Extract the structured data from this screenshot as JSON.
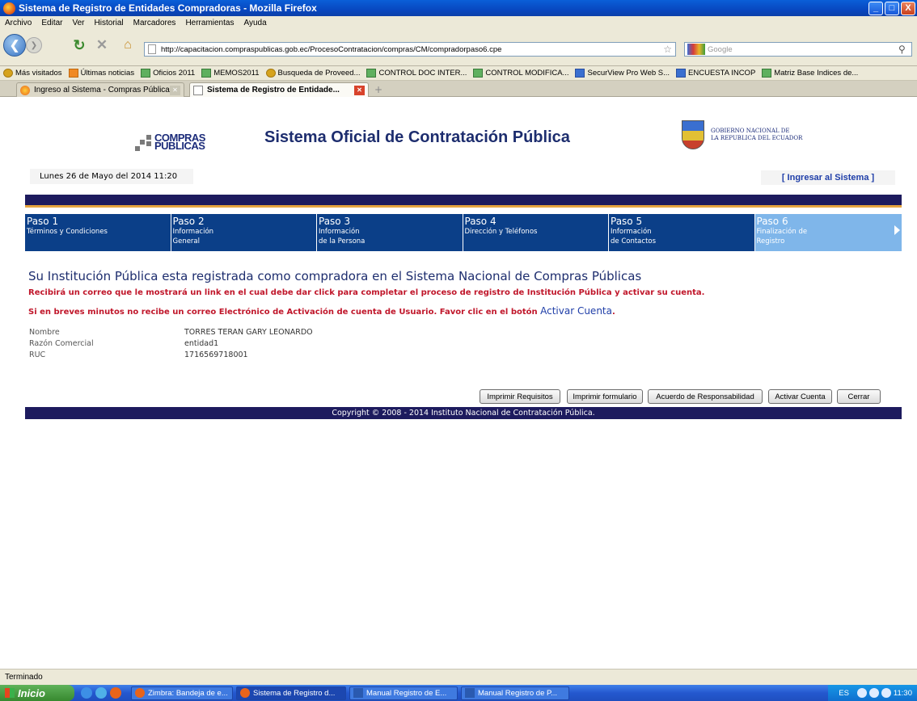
{
  "window": {
    "title": "Sistema de Registro de Entidades Compradoras - Mozilla Firefox",
    "buttons": [
      "_",
      "□",
      "X"
    ]
  },
  "menu": [
    "Archivo",
    "Editar",
    "Ver",
    "Historial",
    "Marcadores",
    "Herramientas",
    "Ayuda"
  ],
  "nav": {
    "url": "http://capacitacion.compraspublicas.gob.ec/ProcesoContratacion/compras/CM/compradorpaso6.cpe",
    "search_placeholder": "Google",
    "icons": [
      "back-icon",
      "forward-icon",
      "reload-icon",
      "stop-icon",
      "home-icon",
      "bookmark-star-icon",
      "search-icon"
    ]
  },
  "bookmarks": [
    {
      "label": "Más visitados",
      "icon": "star"
    },
    {
      "label": "Últimas noticias",
      "icon": "rss"
    },
    {
      "label": "Oficios 2011",
      "icon": "green"
    },
    {
      "label": "MEMOS2011",
      "icon": "green"
    },
    {
      "label": "Busqueda de Proveed...",
      "icon": "star"
    },
    {
      "label": "CONTROL DOC INTER...",
      "icon": "green"
    },
    {
      "label": "CONTROL MODIFICA...",
      "icon": "green"
    },
    {
      "label": "SecurView Pro Web S...",
      "icon": "blue"
    },
    {
      "label": "ENCUESTA INCOP",
      "icon": "blue"
    },
    {
      "label": "Matriz Base Indices de...",
      "icon": "green"
    }
  ],
  "tabs": [
    {
      "label": "Ingreso al Sistema - Compras Públicas",
      "active": false
    },
    {
      "label": "Sistema de Registro de Entidade...",
      "active": true
    }
  ],
  "page": {
    "logo_left": {
      "line1": "COMPRAS",
      "line2": "PÚBLICAS"
    },
    "title": "Sistema Oficial de Contratación Pública",
    "logo_right": {
      "line1": "GOBIERNO NACIONAL DE",
      "line2": "LA REPUBLICA DEL ECUADOR"
    },
    "date": "Lunes 26 de Mayo del 2014 11:20",
    "login_link": "[ Ingresar al Sistema ]",
    "steps": [
      {
        "num": "Paso 1",
        "line1": "Términos y Condiciones",
        "line2": ""
      },
      {
        "num": "Paso 2",
        "line1": "Información",
        "line2": "General"
      },
      {
        "num": "Paso 3",
        "line1": "Información",
        "line2": "de la Persona"
      },
      {
        "num": "Paso 4",
        "line1": "Dirección y Teléfonos",
        "line2": ""
      },
      {
        "num": "Paso 5",
        "line1": "Información",
        "line2": "de Contactos"
      },
      {
        "num": "Paso 6",
        "line1": "Finalización de",
        "line2": "Registro"
      }
    ],
    "heading": "Su Institución Pública esta registrada como compradora en el Sistema Nacional de Compras Públicas",
    "warning1": "Recibirá un correo que le mostrará un link en el cual debe dar click para completar el proceso de registro de Institución Pública y activar su cuenta.",
    "warning2": "Si en breves minutos no recibe un correo Electrónico de Activación de cuenta de Usuario. Favor clic en el botón",
    "warning2_link": "Activar Cuenta",
    "warning2_end": ".",
    "info": [
      {
        "key": "Nombre",
        "value": "TORRES TERAN GARY LEONARDO"
      },
      {
        "key": "Razón Comercial",
        "value": "entidad1"
      },
      {
        "key": "RUC",
        "value": "1716569718001"
      }
    ],
    "buttons": {
      "requisitos": "Imprimir Requisitos",
      "formulario": "Imprimir formulario",
      "acuerdo": "Acuerdo de Responsabilidad",
      "activar": "Activar Cuenta",
      "cerrar": "Cerrar"
    },
    "footer": "Copyright © 2008 - 2014 Instituto Nacional de Contratación Pública."
  },
  "status": "Terminado",
  "taskbar": {
    "start": "Inicio",
    "tasks": [
      {
        "label": "Zimbra: Bandeja de e...",
        "active": false
      },
      {
        "label": "Sistema de Registro d...",
        "active": true
      },
      {
        "label": "Manual Registro de E...",
        "active": false
      },
      {
        "label": "Manual Registro de P...",
        "active": false
      }
    ],
    "lang": "ES",
    "clock": "11:30"
  }
}
